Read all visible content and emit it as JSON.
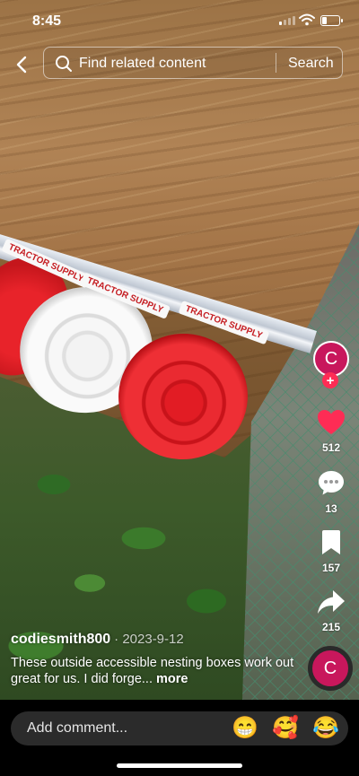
{
  "status_bar": {
    "time": "8:45"
  },
  "search": {
    "placeholder": "Find related content",
    "button": "Search"
  },
  "rail": {
    "avatar_letter": "C",
    "follow_symbol": "+",
    "likes": "512",
    "comments": "13",
    "saves": "157",
    "shares": "215",
    "disc_letter": "C"
  },
  "caption": {
    "username": "codiesmith800",
    "date": "· 2023-9-12",
    "text": "These outside accessible nesting boxes work out great for us. I did forge...",
    "more": "more"
  },
  "video_labels": [
    "TRACTOR SUPPLY",
    "TRACTOR SUPPLY",
    "TRACTOR SUPPLY"
  ],
  "comment_bar": {
    "placeholder": "Add comment...",
    "emojis": [
      "😁",
      "🥰",
      "😂"
    ]
  },
  "colors": {
    "accent": "#fe2c55",
    "avatar": "#c8175c",
    "like": "#fe2c55"
  },
  "icons": [
    "back-icon",
    "search-icon",
    "heart-icon",
    "comment-icon",
    "bookmark-icon",
    "share-icon"
  ]
}
